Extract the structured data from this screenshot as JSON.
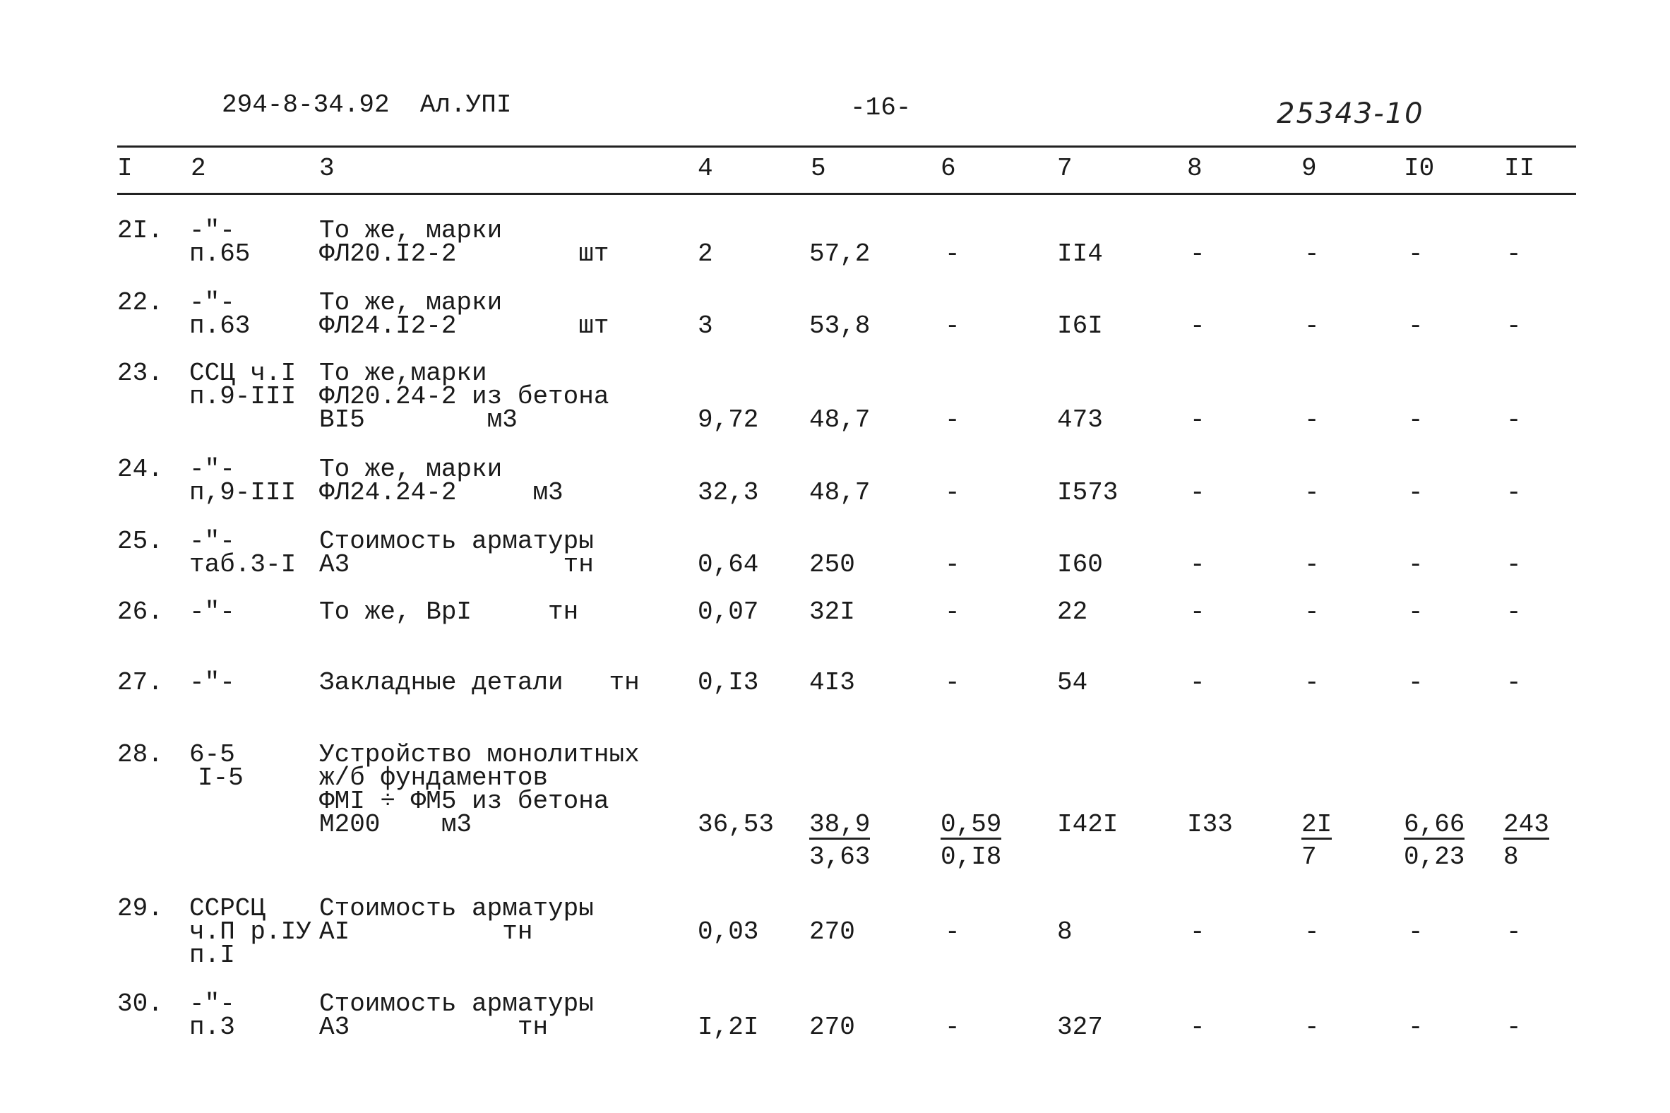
{
  "header": {
    "doc_code": "294-8-34.92  Ал.УПI",
    "page_number": "-16-",
    "handwritten_number": "25343-10"
  },
  "columns": [
    "I",
    "2",
    "3",
    "4",
    "5",
    "6",
    "7",
    "8",
    "9",
    "I0",
    "II"
  ],
  "rows": [
    {
      "no": "2I.",
      "ref": [
        "-\"-",
        "п.65"
      ],
      "desc": [
        "То же, марки",
        "ФЛ20.I2-2        шт"
      ],
      "c4": "2",
      "c5": "57,2",
      "c6": "-",
      "c7": "II4",
      "c8": "-",
      "c9": "-",
      "c10": "-",
      "c11": "-"
    },
    {
      "no": "22.",
      "ref": [
        "-\"-",
        "п.63"
      ],
      "desc": [
        "То же, марки",
        "ФЛ24.I2-2        шт"
      ],
      "c4": "3",
      "c5": "53,8",
      "c6": "-",
      "c7": "I6I",
      "c8": "-",
      "c9": "-",
      "c10": "-",
      "c11": "-"
    },
    {
      "no": "23.",
      "ref": [
        "ССЦ ч.I",
        "п.9-III"
      ],
      "desc": [
        "То же,марки",
        "ФЛ20.24-2 из бетона",
        "BI5        м3"
      ],
      "c4": "9,72",
      "c5": "48,7",
      "c6": "-",
      "c7": "473",
      "c8": "-",
      "c9": "-",
      "c10": "-",
      "c11": "-"
    },
    {
      "no": "24.",
      "ref": [
        "-\"-",
        "п,9-III"
      ],
      "desc": [
        "То же, марки",
        "ФЛ24.24-2     м3"
      ],
      "c4": "32,3",
      "c5": "48,7",
      "c6": "-",
      "c7": "I573",
      "c8": "-",
      "c9": "-",
      "c10": "-",
      "c11": "-"
    },
    {
      "no": "25.",
      "ref": [
        "-\"-",
        "таб.3-I"
      ],
      "desc": [
        "Стоимость арматуры",
        "А3              тн"
      ],
      "c4": "0,64",
      "c5": "250",
      "c6": "-",
      "c7": "I60",
      "c8": "-",
      "c9": "-",
      "c10": "-",
      "c11": "-"
    },
    {
      "no": "26.",
      "ref": [
        "-\"-"
      ],
      "desc": [
        "То же, ВрI     тн"
      ],
      "c4": "0,07",
      "c5": "32I",
      "c6": "-",
      "c7": "22",
      "c8": "-",
      "c9": "-",
      "c10": "-",
      "c11": "-"
    },
    {
      "no": "27.",
      "ref": [
        "-\"-"
      ],
      "desc": [
        "Закладные детали   тн"
      ],
      "c4": "0,I3",
      "c5": "4I3",
      "c6": "-",
      "c7": "54",
      "c8": "-",
      "c9": "-",
      "c10": "-",
      "c11": "-"
    },
    {
      "no": "28.",
      "ref": [
        "6-5",
        "I-5"
      ],
      "desc": [
        "Устройство монолитных",
        "ж/б фундаментов",
        "ФМI ÷ ФМ5 из бетона",
        "М200    м3"
      ],
      "c4": "36,53",
      "c5": {
        "num": "38,9",
        "den": "3,63"
      },
      "c6": {
        "num": "0,59",
        "den": "0,I8"
      },
      "c7": "I42I",
      "c8": "I33",
      "c9": {
        "num": "2I",
        "den": "7"
      },
      "c10": {
        "num": "6,66",
        "den": "0,23"
      },
      "c11": {
        "num": "243",
        "den": "8"
      }
    },
    {
      "no": "29.",
      "ref": [
        "ССРСЦ",
        "ч.П р.IУ",
        "п.I"
      ],
      "desc": [
        "Стоимость арматуры",
        "АI          тн"
      ],
      "c4": "0,03",
      "c5": "270",
      "c6": "-",
      "c7": "8",
      "c8": "-",
      "c9": "-",
      "c10": "-",
      "c11": "-"
    },
    {
      "no": "30.",
      "ref": [
        "-\"-",
        "п.3"
      ],
      "desc": [
        "Стоимость арматуры",
        "А3           тн"
      ],
      "c4": "I,2I",
      "c5": "270",
      "c6": "-",
      "c7": "327",
      "c8": "-",
      "c9": "-",
      "c10": "-",
      "c11": "-"
    }
  ]
}
